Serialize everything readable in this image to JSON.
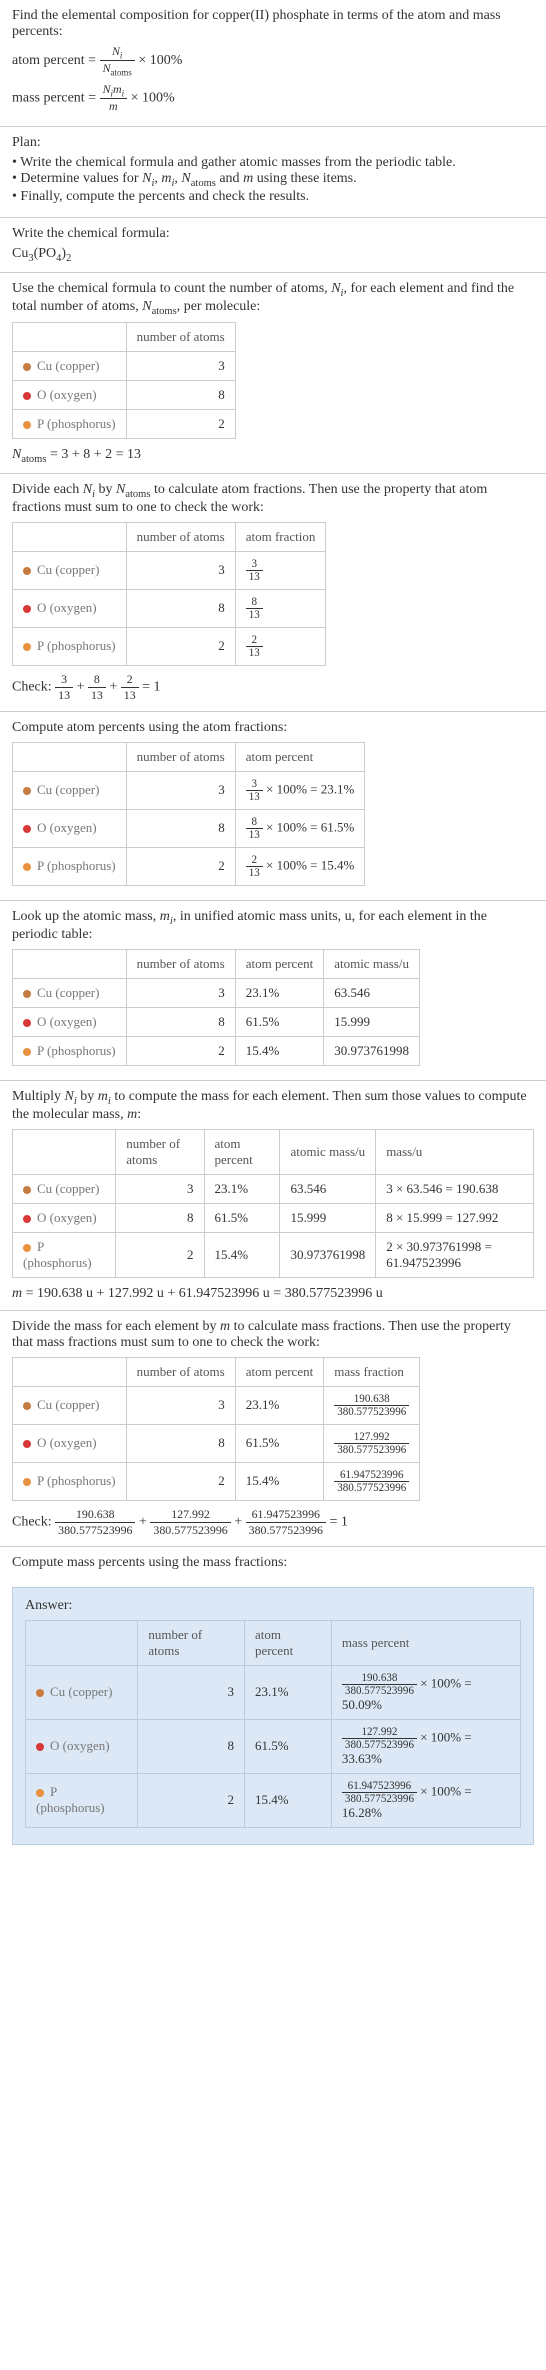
{
  "intro": {
    "question": "Find the elemental composition for copper(II) phosphate in terms of the atom and mass percents:",
    "atom_percent_label": "atom percent = ",
    "atom_percent_times": " × 100%",
    "mass_percent_label": "mass percent = ",
    "mass_percent_times": " × 100%",
    "N_i": "N",
    "N_i_sub": "i",
    "N_atoms": "N",
    "N_atoms_sub": "atoms",
    "Nimi_num1": "N",
    "Nimi_num1_sub": "i",
    "Nimi_num2": "m",
    "Nimi_num2_sub": "i",
    "m_den": "m"
  },
  "plan": {
    "title": "Plan:",
    "b1": "Write the chemical formula and gather atomic masses from the periodic table.",
    "b2_pre": "Determine values for ",
    "b2_Ni": "N",
    "b2_Ni_sub": "i",
    "b2_mid1": ", ",
    "b2_mi": "m",
    "b2_mi_sub": "i",
    "b2_mid2": ", ",
    "b2_Na": "N",
    "b2_Na_sub": "atoms",
    "b2_mid3": " and ",
    "b2_m": "m",
    "b2_end": " using these items.",
    "b3": "Finally, compute the percents and check the results."
  },
  "step1": {
    "title": "Write the chemical formula:",
    "formula_cu": "Cu",
    "formula_3": "3",
    "formula_po": "(PO",
    "formula_4": "4",
    "formula_close": ")",
    "formula_2": "2"
  },
  "step2": {
    "title_pre": "Use the chemical formula to count the number of atoms, ",
    "title_Ni": "N",
    "title_Ni_sub": "i",
    "title_mid": ", for each element and find the total number of atoms, ",
    "title_Na": "N",
    "title_Na_sub": "atoms",
    "title_end": ", per molecule:",
    "th_num": "number of atoms",
    "cu_label": "Cu (copper)",
    "cu_n": "3",
    "o_label": "O (oxygen)",
    "o_n": "8",
    "p_label": "P (phosphorus)",
    "p_n": "2",
    "sum_pre": "N",
    "sum_sub": "atoms",
    "sum_rest": " = 3 + 8 + 2 = 13"
  },
  "step3": {
    "title_pre": "Divide each ",
    "title_Ni": "N",
    "title_Ni_sub": "i",
    "title_mid": " by ",
    "title_Na": "N",
    "title_Na_sub": "atoms",
    "title_end": " to calculate atom fractions. Then use the property that atom fractions must sum to one to check the work:",
    "th_num": "number of atoms",
    "th_frac": "atom fraction",
    "cu_n": "3",
    "cu_fn": "3",
    "cu_fd": "13",
    "o_n": "8",
    "o_fn": "8",
    "o_fd": "13",
    "p_n": "2",
    "p_fn": "2",
    "p_fd": "13",
    "check_pre": "Check: ",
    "check_eq": " = 1"
  },
  "step4": {
    "title": "Compute atom percents using the atom fractions:",
    "th_num": "number of atoms",
    "th_ap": "atom percent",
    "cu_n": "3",
    "cu_fn": "3",
    "cu_fd": "13",
    "cu_res": " × 100% = 23.1%",
    "o_n": "8",
    "o_fn": "8",
    "o_fd": "13",
    "o_res": " × 100% = 61.5%",
    "p_n": "2",
    "p_fn": "2",
    "p_fd": "13",
    "p_res": " × 100% = 15.4%"
  },
  "step5": {
    "title_pre": "Look up the atomic mass, ",
    "title_mi": "m",
    "title_mi_sub": "i",
    "title_end": ", in unified atomic mass units, u, for each element in the periodic table:",
    "th_num": "number of atoms",
    "th_ap": "atom percent",
    "th_am": "atomic mass/u",
    "cu_n": "3",
    "cu_ap": "23.1%",
    "cu_am": "63.546",
    "o_n": "8",
    "o_ap": "61.5%",
    "o_am": "15.999",
    "p_n": "2",
    "p_ap": "15.4%",
    "p_am": "30.973761998"
  },
  "step6": {
    "title_pre": "Multiply ",
    "title_Ni": "N",
    "title_Ni_sub": "i",
    "title_mid1": " by ",
    "title_mi": "m",
    "title_mi_sub": "i",
    "title_mid2": " to compute the mass for each element. Then sum those values to compute the molecular mass, ",
    "title_m": "m",
    "title_end": ":",
    "th_num": "number of atoms",
    "th_ap": "atom percent",
    "th_am": "atomic mass/u",
    "th_mass": "mass/u",
    "cu_n": "3",
    "cu_ap": "23.1%",
    "cu_am": "63.546",
    "cu_mass": "3 × 63.546 = 190.638",
    "o_n": "8",
    "o_ap": "61.5%",
    "o_am": "15.999",
    "o_mass": "8 × 15.999 = 127.992",
    "p_n": "2",
    "p_ap": "15.4%",
    "p_am": "30.973761998",
    "p_mass": "2 × 30.973761998 = 61.947523996",
    "sum": "m = 190.638 u + 127.992 u + 61.947523996 u = 380.577523996 u",
    "sum_m": "m",
    "sum_rest": " = 190.638 u + 127.992 u + 61.947523996 u = 380.577523996 u"
  },
  "step7": {
    "title_pre": "Divide the mass for each element by ",
    "title_m": "m",
    "title_end": " to calculate mass fractions. Then use the property that mass fractions must sum to one to check the work:",
    "th_num": "number of atoms",
    "th_ap": "atom percent",
    "th_mf": "mass fraction",
    "cu_n": "3",
    "cu_ap": "23.1%",
    "cu_fn": "190.638",
    "cu_fd": "380.577523996",
    "o_n": "8",
    "o_ap": "61.5%",
    "o_fn": "127.992",
    "o_fd": "380.577523996",
    "p_n": "2",
    "p_ap": "15.4%",
    "p_fn": "61.947523996",
    "p_fd": "380.577523996",
    "check_pre": "Check: ",
    "check_eq": " = 1"
  },
  "step8": {
    "title": "Compute mass percents using the mass fractions:"
  },
  "answer": {
    "label": "Answer:",
    "th_num": "number of atoms",
    "th_ap": "atom percent",
    "th_mp": "mass percent",
    "cu_n": "3",
    "cu_ap": "23.1%",
    "cu_fn": "190.638",
    "cu_fd": "380.577523996",
    "cu_res": " × 100% = 50.09%",
    "o_n": "8",
    "o_ap": "61.5%",
    "o_fn": "127.992",
    "o_fd": "380.577523996",
    "o_res": " × 100% = 33.63%",
    "p_n": "2",
    "p_ap": "15.4%",
    "p_fn": "61.947523996",
    "p_fd": "380.577523996",
    "p_res": " × 100% = 16.28%"
  },
  "elements": {
    "cu": "Cu (copper)",
    "o": "O (oxygen)",
    "p": "P (phosphorus)"
  }
}
